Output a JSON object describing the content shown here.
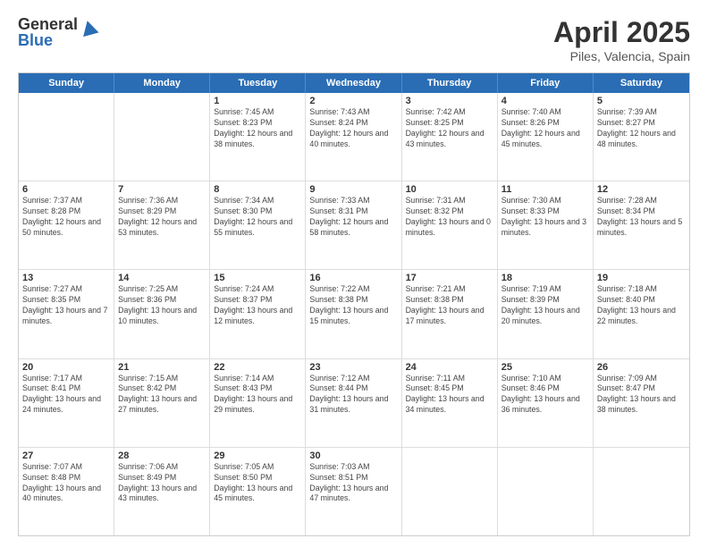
{
  "logo": {
    "general": "General",
    "blue": "Blue"
  },
  "title": {
    "main": "April 2025",
    "sub": "Piles, Valencia, Spain"
  },
  "header_days": [
    "Sunday",
    "Monday",
    "Tuesday",
    "Wednesday",
    "Thursday",
    "Friday",
    "Saturday"
  ],
  "weeks": [
    [
      {
        "day": "",
        "sunrise": "",
        "sunset": "",
        "daylight": ""
      },
      {
        "day": "",
        "sunrise": "",
        "sunset": "",
        "daylight": ""
      },
      {
        "day": "1",
        "sunrise": "Sunrise: 7:45 AM",
        "sunset": "Sunset: 8:23 PM",
        "daylight": "Daylight: 12 hours and 38 minutes."
      },
      {
        "day": "2",
        "sunrise": "Sunrise: 7:43 AM",
        "sunset": "Sunset: 8:24 PM",
        "daylight": "Daylight: 12 hours and 40 minutes."
      },
      {
        "day": "3",
        "sunrise": "Sunrise: 7:42 AM",
        "sunset": "Sunset: 8:25 PM",
        "daylight": "Daylight: 12 hours and 43 minutes."
      },
      {
        "day": "4",
        "sunrise": "Sunrise: 7:40 AM",
        "sunset": "Sunset: 8:26 PM",
        "daylight": "Daylight: 12 hours and 45 minutes."
      },
      {
        "day": "5",
        "sunrise": "Sunrise: 7:39 AM",
        "sunset": "Sunset: 8:27 PM",
        "daylight": "Daylight: 12 hours and 48 minutes."
      }
    ],
    [
      {
        "day": "6",
        "sunrise": "Sunrise: 7:37 AM",
        "sunset": "Sunset: 8:28 PM",
        "daylight": "Daylight: 12 hours and 50 minutes."
      },
      {
        "day": "7",
        "sunrise": "Sunrise: 7:36 AM",
        "sunset": "Sunset: 8:29 PM",
        "daylight": "Daylight: 12 hours and 53 minutes."
      },
      {
        "day": "8",
        "sunrise": "Sunrise: 7:34 AM",
        "sunset": "Sunset: 8:30 PM",
        "daylight": "Daylight: 12 hours and 55 minutes."
      },
      {
        "day": "9",
        "sunrise": "Sunrise: 7:33 AM",
        "sunset": "Sunset: 8:31 PM",
        "daylight": "Daylight: 12 hours and 58 minutes."
      },
      {
        "day": "10",
        "sunrise": "Sunrise: 7:31 AM",
        "sunset": "Sunset: 8:32 PM",
        "daylight": "Daylight: 13 hours and 0 minutes."
      },
      {
        "day": "11",
        "sunrise": "Sunrise: 7:30 AM",
        "sunset": "Sunset: 8:33 PM",
        "daylight": "Daylight: 13 hours and 3 minutes."
      },
      {
        "day": "12",
        "sunrise": "Sunrise: 7:28 AM",
        "sunset": "Sunset: 8:34 PM",
        "daylight": "Daylight: 13 hours and 5 minutes."
      }
    ],
    [
      {
        "day": "13",
        "sunrise": "Sunrise: 7:27 AM",
        "sunset": "Sunset: 8:35 PM",
        "daylight": "Daylight: 13 hours and 7 minutes."
      },
      {
        "day": "14",
        "sunrise": "Sunrise: 7:25 AM",
        "sunset": "Sunset: 8:36 PM",
        "daylight": "Daylight: 13 hours and 10 minutes."
      },
      {
        "day": "15",
        "sunrise": "Sunrise: 7:24 AM",
        "sunset": "Sunset: 8:37 PM",
        "daylight": "Daylight: 13 hours and 12 minutes."
      },
      {
        "day": "16",
        "sunrise": "Sunrise: 7:22 AM",
        "sunset": "Sunset: 8:38 PM",
        "daylight": "Daylight: 13 hours and 15 minutes."
      },
      {
        "day": "17",
        "sunrise": "Sunrise: 7:21 AM",
        "sunset": "Sunset: 8:38 PM",
        "daylight": "Daylight: 13 hours and 17 minutes."
      },
      {
        "day": "18",
        "sunrise": "Sunrise: 7:19 AM",
        "sunset": "Sunset: 8:39 PM",
        "daylight": "Daylight: 13 hours and 20 minutes."
      },
      {
        "day": "19",
        "sunrise": "Sunrise: 7:18 AM",
        "sunset": "Sunset: 8:40 PM",
        "daylight": "Daylight: 13 hours and 22 minutes."
      }
    ],
    [
      {
        "day": "20",
        "sunrise": "Sunrise: 7:17 AM",
        "sunset": "Sunset: 8:41 PM",
        "daylight": "Daylight: 13 hours and 24 minutes."
      },
      {
        "day": "21",
        "sunrise": "Sunrise: 7:15 AM",
        "sunset": "Sunset: 8:42 PM",
        "daylight": "Daylight: 13 hours and 27 minutes."
      },
      {
        "day": "22",
        "sunrise": "Sunrise: 7:14 AM",
        "sunset": "Sunset: 8:43 PM",
        "daylight": "Daylight: 13 hours and 29 minutes."
      },
      {
        "day": "23",
        "sunrise": "Sunrise: 7:12 AM",
        "sunset": "Sunset: 8:44 PM",
        "daylight": "Daylight: 13 hours and 31 minutes."
      },
      {
        "day": "24",
        "sunrise": "Sunrise: 7:11 AM",
        "sunset": "Sunset: 8:45 PM",
        "daylight": "Daylight: 13 hours and 34 minutes."
      },
      {
        "day": "25",
        "sunrise": "Sunrise: 7:10 AM",
        "sunset": "Sunset: 8:46 PM",
        "daylight": "Daylight: 13 hours and 36 minutes."
      },
      {
        "day": "26",
        "sunrise": "Sunrise: 7:09 AM",
        "sunset": "Sunset: 8:47 PM",
        "daylight": "Daylight: 13 hours and 38 minutes."
      }
    ],
    [
      {
        "day": "27",
        "sunrise": "Sunrise: 7:07 AM",
        "sunset": "Sunset: 8:48 PM",
        "daylight": "Daylight: 13 hours and 40 minutes."
      },
      {
        "day": "28",
        "sunrise": "Sunrise: 7:06 AM",
        "sunset": "Sunset: 8:49 PM",
        "daylight": "Daylight: 13 hours and 43 minutes."
      },
      {
        "day": "29",
        "sunrise": "Sunrise: 7:05 AM",
        "sunset": "Sunset: 8:50 PM",
        "daylight": "Daylight: 13 hours and 45 minutes."
      },
      {
        "day": "30",
        "sunrise": "Sunrise: 7:03 AM",
        "sunset": "Sunset: 8:51 PM",
        "daylight": "Daylight: 13 hours and 47 minutes."
      },
      {
        "day": "",
        "sunrise": "",
        "sunset": "",
        "daylight": ""
      },
      {
        "day": "",
        "sunrise": "",
        "sunset": "",
        "daylight": ""
      },
      {
        "day": "",
        "sunrise": "",
        "sunset": "",
        "daylight": ""
      }
    ]
  ]
}
